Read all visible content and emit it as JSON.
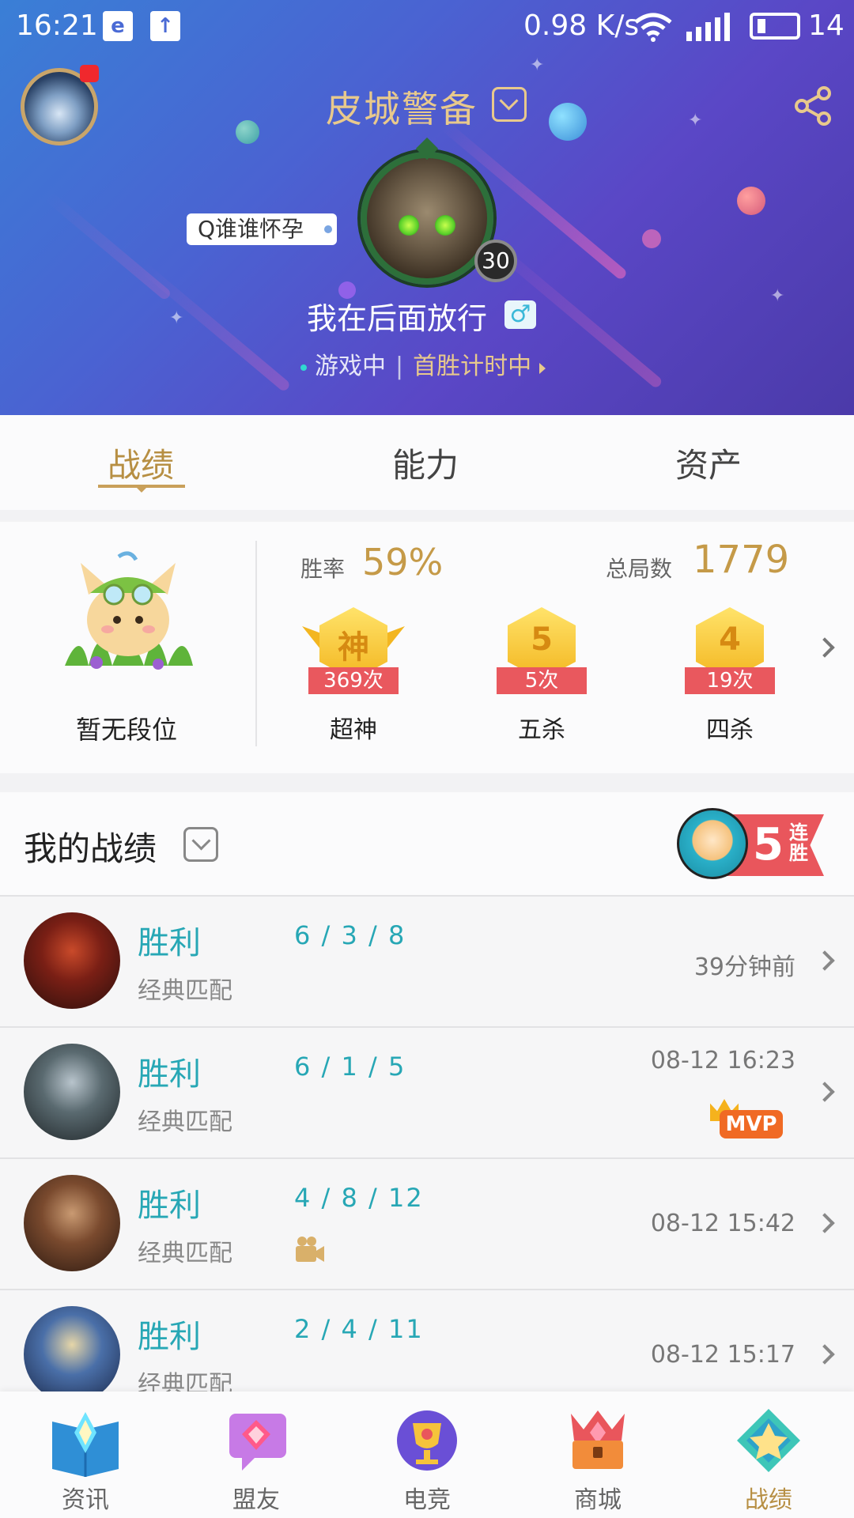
{
  "status_bar": {
    "time": "16:21",
    "net_speed": "0.98 K/s",
    "network": "4G",
    "battery": "14"
  },
  "header": {
    "server": "皮城警备",
    "qq_name": "Q谁谁怀孕",
    "level": "30",
    "nickname": "我在后面放行",
    "gender_symbol": "♂",
    "game_status": "游戏中",
    "separator": "|",
    "first_win": "首胜计时中"
  },
  "tabs": [
    {
      "label": "战绩",
      "active": true
    },
    {
      "label": "能力",
      "active": false
    },
    {
      "label": "资产",
      "active": false
    }
  ],
  "stats": {
    "rank": "暂无段位",
    "win_rate_label": "胜率",
    "win_rate": "59%",
    "total_label": "总局数",
    "total_games": "1779",
    "medals": [
      {
        "glyph": "神",
        "count": "369次",
        "name": "超神"
      },
      {
        "glyph": "5",
        "count": "5次",
        "name": "五杀"
      },
      {
        "glyph": "4",
        "count": "19次",
        "name": "四杀"
      }
    ]
  },
  "records": {
    "title": "我的战绩",
    "streak_num": "5",
    "streak_text": "连胜",
    "rows": [
      {
        "result": "胜利",
        "mode": "经典匹配",
        "kda": "6 / 3 / 8",
        "time": "39分钟前",
        "mvp": false,
        "video": false
      },
      {
        "result": "胜利",
        "mode": "经典匹配",
        "kda": "6 / 1 / 5",
        "time": "08-12 16:23",
        "mvp": true,
        "video": false
      },
      {
        "result": "胜利",
        "mode": "经典匹配",
        "kda": "4 / 8 / 12",
        "time": "08-12 15:42",
        "mvp": false,
        "video": true
      },
      {
        "result": "胜利",
        "mode": "经典匹配",
        "kda": "2 / 4 / 11",
        "time": "08-12 15:17",
        "mvp": false,
        "video": false
      }
    ],
    "mvp_label": "MVP"
  },
  "bottom_nav": [
    {
      "label": "资讯",
      "icon": "news-book-icon"
    },
    {
      "label": "盟友",
      "icon": "friends-heart-icon"
    },
    {
      "label": "电竞",
      "icon": "esports-trophy-icon"
    },
    {
      "label": "商城",
      "icon": "store-chest-icon"
    },
    {
      "label": "战绩",
      "icon": "record-emblem-icon",
      "active": true
    }
  ],
  "colors": {
    "gold": "#c59a48",
    "teal": "#27a7b5",
    "header_start": "#3a7fd6",
    "header_end": "#4b3aa9"
  }
}
